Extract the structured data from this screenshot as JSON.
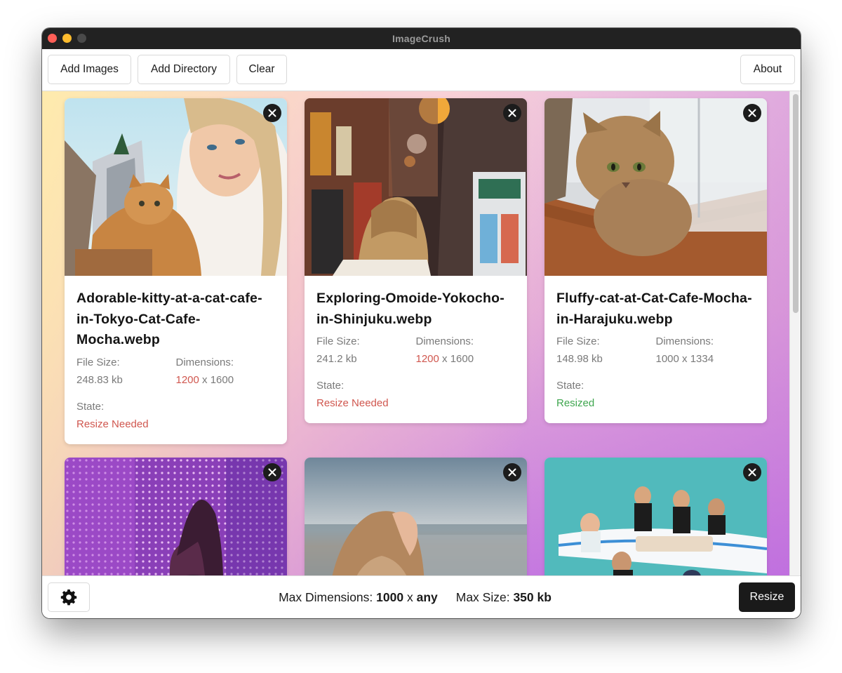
{
  "window": {
    "title": "ImageCrush"
  },
  "toolbar": {
    "add_images": "Add Images",
    "add_directory": "Add Directory",
    "clear": "Clear",
    "about": "About"
  },
  "labels": {
    "file_size": "File Size:",
    "dimensions": "Dimensions:",
    "state": "State:",
    "dim_separator": "x"
  },
  "cards": [
    {
      "filename": "Adorable-kitty-at-a-cat-cafe-in-Tokyo-Cat-Cafe-Mocha.webp",
      "file_size": "248.83 kb",
      "width": "1200",
      "height": "1600",
      "state": "Resize Needed"
    },
    {
      "filename": "Exploring-Omoide-Yokocho-in-Shinjuku.webp",
      "file_size": "241.2 kb",
      "width": "1200",
      "height": "1600",
      "state": "Resize Needed"
    },
    {
      "filename": "Fluffy-cat-at-Cat-Cafe-Mocha-in-Harajuku.webp",
      "file_size": "148.98 kb",
      "width": "1000",
      "height": "1334",
      "state": "Resized"
    },
    {
      "filename": "",
      "state": ""
    },
    {
      "filename": "",
      "state": ""
    },
    {
      "filename": "",
      "state": ""
    }
  ],
  "footer": {
    "max_dimensions_label": "Max Dimensions:",
    "max_width": "1000",
    "dim_separator": "x",
    "max_height": "any",
    "max_size_label": "Max Size:",
    "max_size_value": "350 kb",
    "resize_button": "Resize"
  },
  "colors": {
    "needs_resize": "#d0574f",
    "resized": "#3fa64f",
    "titlebar": "#222222"
  },
  "icons": [
    "close-icon",
    "gear-icon"
  ]
}
